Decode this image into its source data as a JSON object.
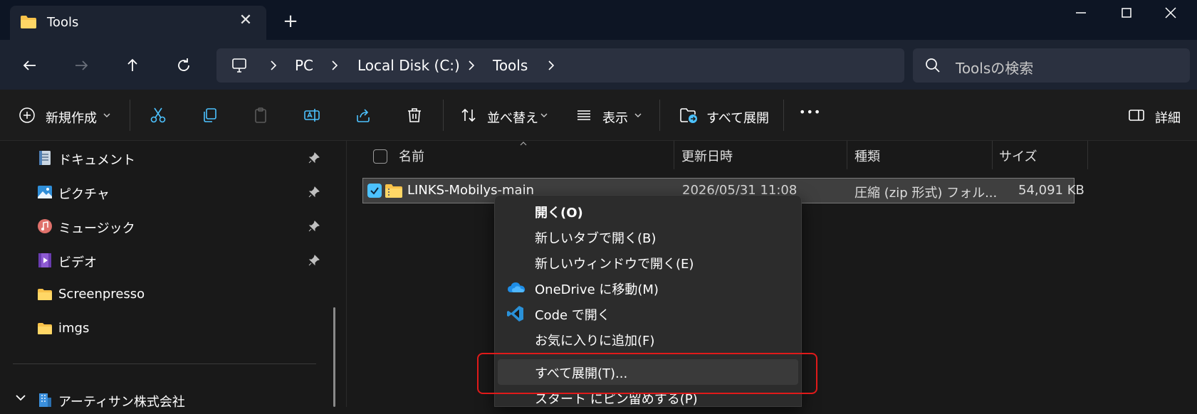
{
  "window": {
    "tab_title": "Tools",
    "close_tab": "✕",
    "new_tab": "+"
  },
  "address": {
    "crumbs": [
      "PC",
      "Local Disk (C:)",
      "Tools"
    ],
    "search_placeholder": "Toolsの検索"
  },
  "toolbar": {
    "new_label": "新規作成",
    "sort_label": "並べ替え",
    "view_label": "表示",
    "extract_all_label": "すべて展開",
    "more_label": "•••",
    "details_label": "詳細"
  },
  "sidebar": {
    "items": [
      {
        "label": "ドキュメント",
        "pinned": true,
        "icon": "document-icon"
      },
      {
        "label": "ピクチャ",
        "pinned": true,
        "icon": "pictures-icon"
      },
      {
        "label": "ミュージック",
        "pinned": true,
        "icon": "music-icon"
      },
      {
        "label": "ビデオ",
        "pinned": true,
        "icon": "video-icon"
      },
      {
        "label": "Screenpresso",
        "pinned": false,
        "icon": "folder-icon"
      },
      {
        "label": "imgs",
        "pinned": false,
        "icon": "folder-icon"
      }
    ],
    "org_label": "アーティサン株式会社"
  },
  "columns": {
    "name": "名前",
    "modified": "更新日時",
    "type": "種類",
    "size": "サイズ"
  },
  "file": {
    "name": "LINKS-Mobilys-main",
    "modified": "2026/05/31 11:08",
    "type": "圧縮 (zip 形式) フォル...",
    "size": "54,091 KB"
  },
  "context_menu": {
    "open": "開く(O)",
    "open_new_tab": "新しいタブで開く(B)",
    "open_new_window": "新しいウィンドウで開く(E)",
    "onedrive": "OneDrive に移動(M)",
    "code": "Code で開く",
    "favorites": "お気に入りに追加(F)",
    "extract_all": "すべて展開(T)...",
    "pin_start": "スタート にピン留めする(P)"
  },
  "colors": {
    "accent": "#4cc2ff",
    "highlight_border": "#e01a1a",
    "folder": "#f8c24a"
  }
}
